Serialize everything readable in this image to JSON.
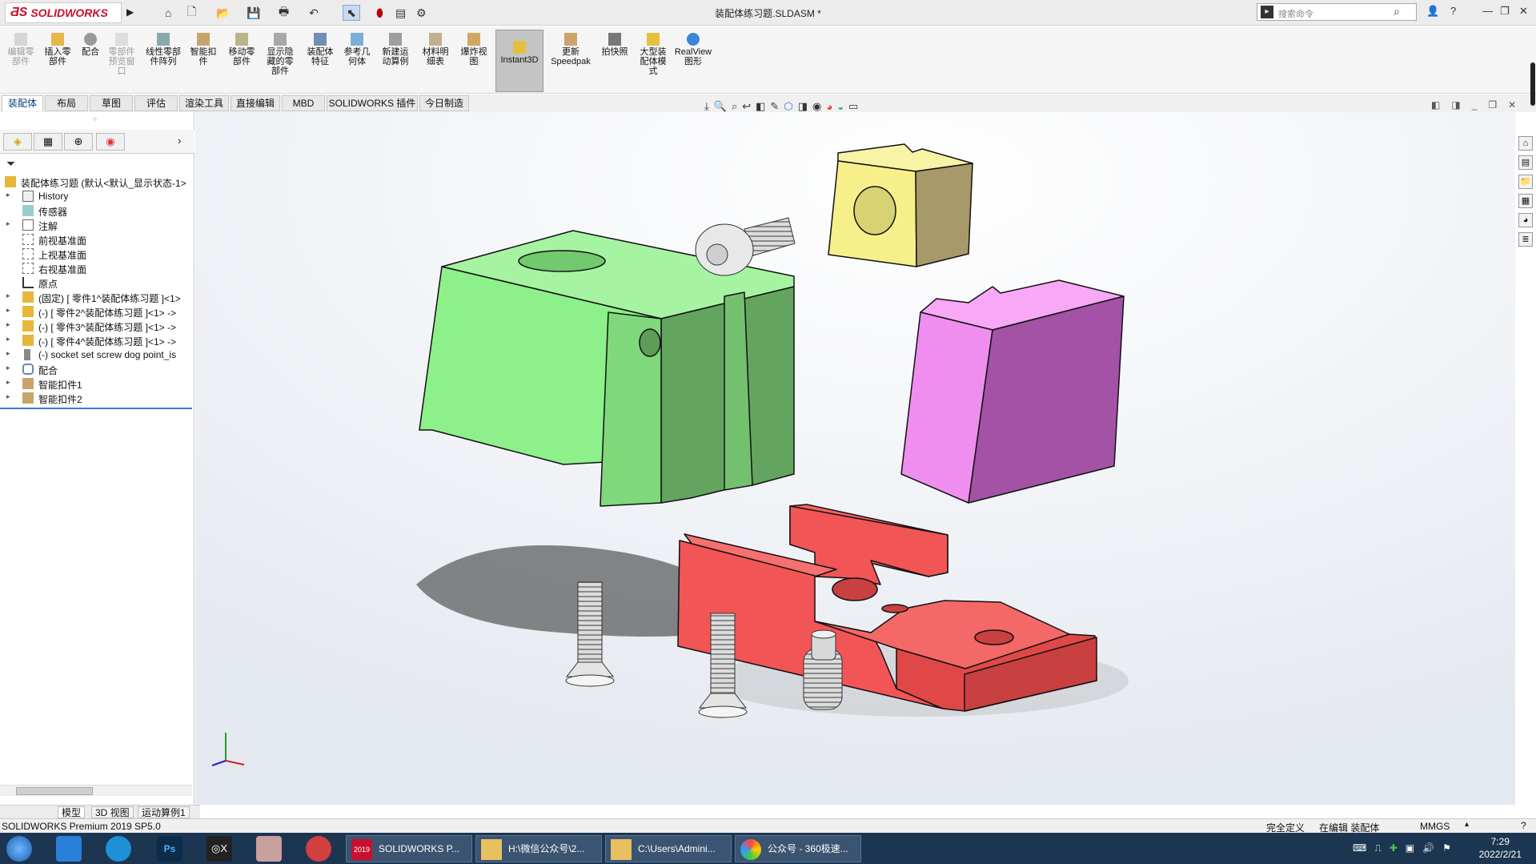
{
  "app": {
    "logo": "SOLIDWORKS",
    "title": "装配体练习题.SLDASM *"
  },
  "search": {
    "placeholder": "搜索命令"
  },
  "ribbon": {
    "buttons": [
      {
        "label": "编辑零\n部件",
        "disabled": true
      },
      {
        "label": "插入零\n部件"
      },
      {
        "label": "配合"
      },
      {
        "label": "零部件\n预览窗\n口",
        "disabled": true
      },
      {
        "label": "线性零部\n件阵列"
      },
      {
        "label": "智能扣\n件"
      },
      {
        "label": "移动零\n部件"
      },
      {
        "label": "显示隐\n藏的零\n部件"
      },
      {
        "label": "装配体\n特征"
      },
      {
        "label": "参考几\n何体"
      },
      {
        "label": "新建运\n动算例"
      },
      {
        "label": "材料明\n细表"
      },
      {
        "label": "爆炸视\n图"
      },
      {
        "label": "Instant3D"
      },
      {
        "label": "更新\nSpeedpak"
      },
      {
        "label": "拍快照"
      },
      {
        "label": "大型装\n配体模\n式"
      },
      {
        "label": "RealView\n图形"
      }
    ]
  },
  "tabs": [
    "装配体",
    "布局",
    "草图",
    "评估",
    "渲染工具",
    "直接编辑",
    "MBD",
    "SOLIDWORKS 插件",
    "今日制造"
  ],
  "tree": {
    "root": "装配体练习题  (默认<默认_显示状态-1>",
    "items": [
      {
        "label": "History",
        "expand": true
      },
      {
        "label": "传感器",
        "expand": false
      },
      {
        "label": "注解",
        "expand": true
      },
      {
        "label": "前视基准面",
        "expand": false
      },
      {
        "label": "上视基准面",
        "expand": false
      },
      {
        "label": "右视基准面",
        "expand": false
      },
      {
        "label": "原点",
        "expand": false
      },
      {
        "label": "(固定) [ 零件1^装配体练习题 ]<1>",
        "expand": true
      },
      {
        "label": "(-) [ 零件2^装配体练习题 ]<1> ->",
        "expand": true
      },
      {
        "label": "(-) [ 零件3^装配体练习题 ]<1> ->",
        "expand": true
      },
      {
        "label": "(-) [ 零件4^装配体练习题 ]<1> ->",
        "expand": true
      },
      {
        "label": "(-) socket set screw dog point_is",
        "expand": true
      },
      {
        "label": "配合",
        "expand": true
      },
      {
        "label": "智能扣件1",
        "expand": true
      },
      {
        "label": "智能扣件2",
        "expand": true
      }
    ]
  },
  "bottom_tabs": [
    "模型",
    "3D 视图",
    "运动算例1"
  ],
  "status": {
    "left": "SOLIDWORKS Premium 2019 SP5.0",
    "state": "完全定义",
    "mode": "在编辑 装配体",
    "units": "MMGS"
  },
  "taskbar": {
    "buttons": [
      "SOLIDWORKS P...",
      "H:\\微信公众号\\2...",
      "C:\\Users\\Admini...",
      "公众号 - 360极速..."
    ],
    "time": "7:29",
    "date": "2022/2/21",
    "sw_year": "2019"
  },
  "colors": {
    "green": "#8ef08a",
    "magenta": "#f08ef0",
    "yellow": "#f7f08a",
    "red": "#f25555"
  }
}
